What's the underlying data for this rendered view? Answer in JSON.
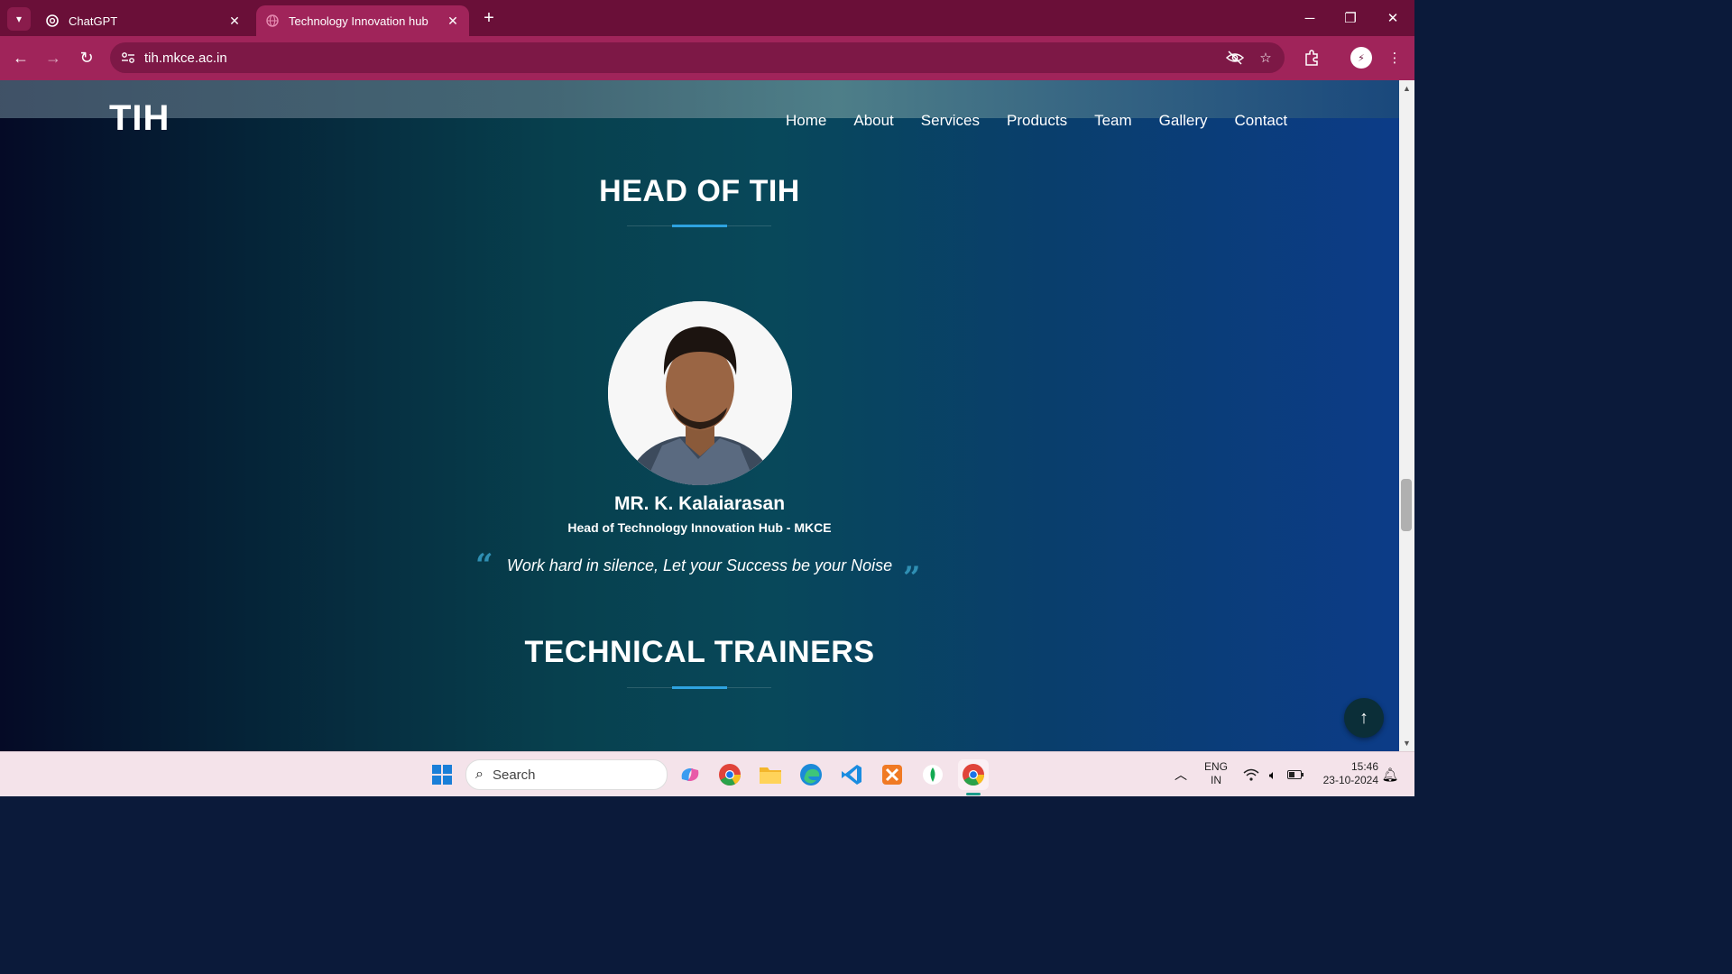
{
  "browser": {
    "tabs": [
      {
        "title": "ChatGPT",
        "icon": "chatgpt-icon",
        "active": false
      },
      {
        "title": "Technology Innovation hub",
        "icon": "globe-icon",
        "active": true
      }
    ],
    "url": "tih.mkce.ac.in"
  },
  "site": {
    "logo": "TIH",
    "nav": [
      "Home",
      "About",
      "Services",
      "Products",
      "Team",
      "Gallery",
      "Contact"
    ]
  },
  "head_section": {
    "title": "HEAD OF TIH",
    "name": "MR. K. Kalaiarasan",
    "role": "Head of Technology Innovation Hub - MKCE",
    "quote": "Work hard in silence, Let your Success be your Noise"
  },
  "trainers_section": {
    "title": "TECHNICAL TRAINERS"
  },
  "taskbar": {
    "search_placeholder": "Search",
    "language_line1": "ENG",
    "language_line2": "IN",
    "time": "15:46",
    "date": "23-10-2024"
  },
  "colors": {
    "tab_bar": "#6a0f38",
    "toolbar": "#a0245a",
    "accent": "#2ea3e0",
    "quote_mark": "#2f8fb3"
  }
}
